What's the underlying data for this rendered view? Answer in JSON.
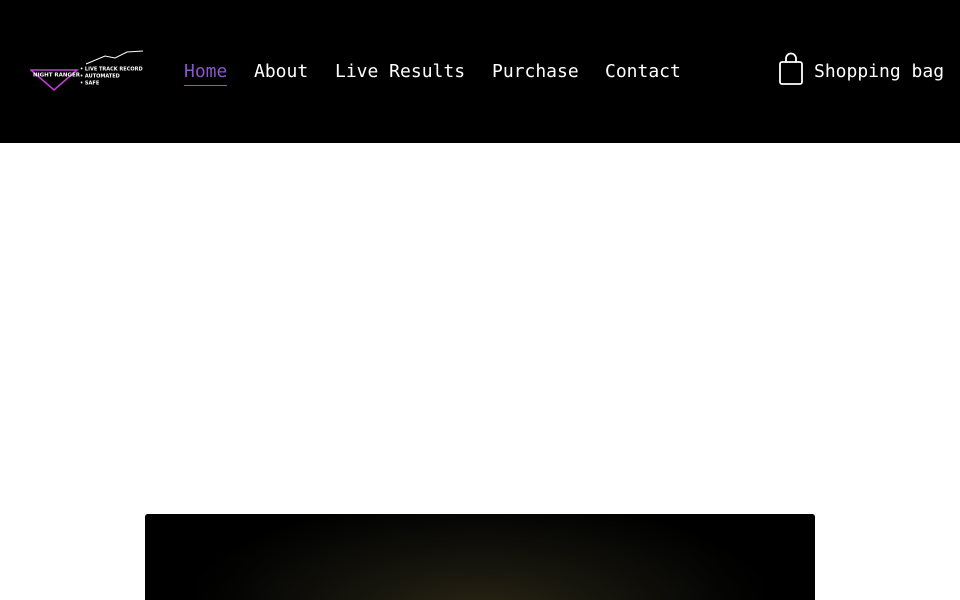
{
  "brand": {
    "logo_name": "NIGHT RANGER",
    "logo_bullets": [
      "• LIVE TRACK RECORD",
      "• AUTOMATED",
      "• SAFE"
    ],
    "logo_accent": "#c23bd4"
  },
  "nav": {
    "items": [
      {
        "label": "Home",
        "active": true
      },
      {
        "label": "About",
        "active": false
      },
      {
        "label": "Live Results",
        "active": false
      },
      {
        "label": "Purchase",
        "active": false
      },
      {
        "label": "Contact",
        "active": false
      }
    ],
    "active_color": "#8a56c9"
  },
  "cart": {
    "label": "Shopping bag",
    "icon": "shopping-bag-icon"
  },
  "hero": {
    "background": "dark video/image panel"
  }
}
